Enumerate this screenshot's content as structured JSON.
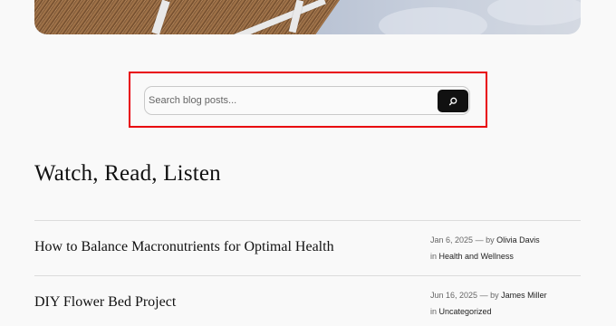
{
  "search": {
    "placeholder": "Search blog posts...",
    "icon": "search-icon"
  },
  "section": {
    "title": "Watch, Read, Listen"
  },
  "posts": [
    {
      "title": "How to Balance Macronutrients for Optimal Health",
      "date": "Jan 6, 2025",
      "by_prefix": "— by",
      "author": "Olivia Davis",
      "in_prefix": "in",
      "category": "Health and Wellness"
    },
    {
      "title": "DIY Flower Bed Project",
      "date": "Jun 16, 2025",
      "by_prefix": "— by",
      "author": "James Miller",
      "in_prefix": "in",
      "category": "Uncategorized"
    }
  ],
  "colors": {
    "highlight": "#e8000b",
    "button": "#111111",
    "background": "#f9f9f9"
  }
}
